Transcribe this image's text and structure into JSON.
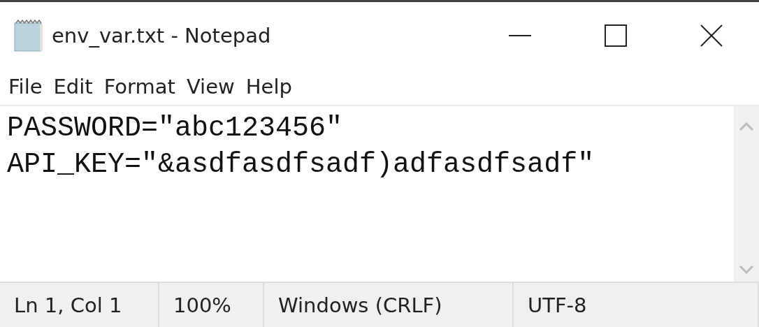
{
  "window": {
    "title": "env_var.txt - Notepad"
  },
  "menu": [
    "File",
    "Edit",
    "Format",
    "View",
    "Help"
  ],
  "editor": {
    "lines": [
      "PASSWORD=\"abc123456\"",
      "API_KEY=\"&asdfasdfsadf)adfasdfsadf\""
    ]
  },
  "status_bar": [
    "Ln 1, Col 1",
    "100%",
    "Windows (CRLF)",
    "UTF-8"
  ]
}
